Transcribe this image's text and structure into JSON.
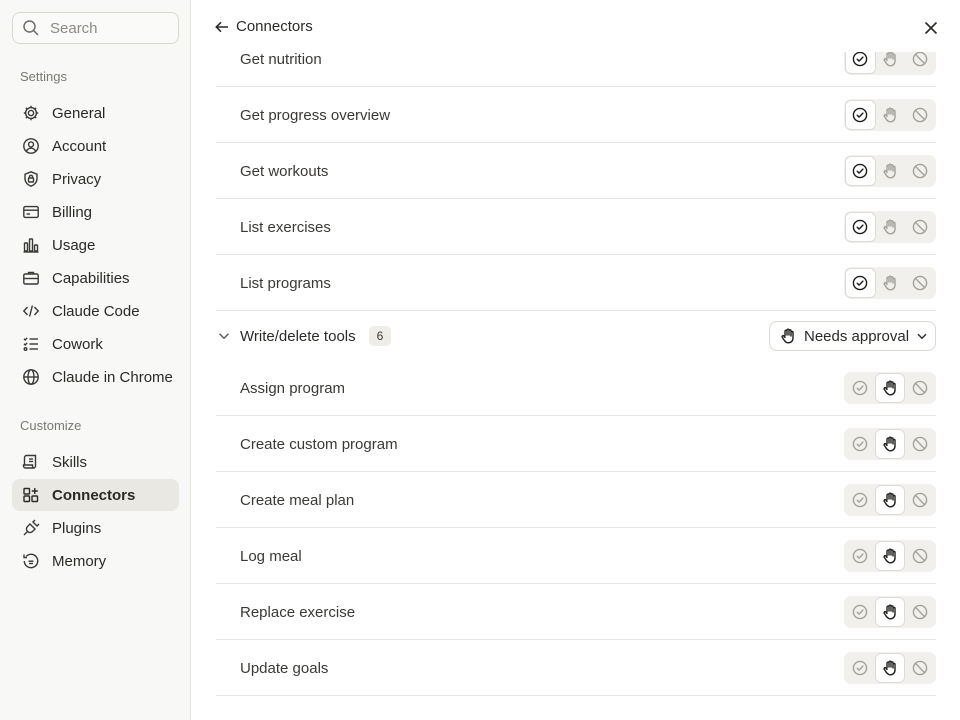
{
  "sidebar": {
    "search_placeholder": "Search",
    "settings_label": "Settings",
    "customize_label": "Customize",
    "settings_items": [
      {
        "label": "General",
        "icon": "gear-icon"
      },
      {
        "label": "Account",
        "icon": "user-circle-icon"
      },
      {
        "label": "Privacy",
        "icon": "shield-lock-icon"
      },
      {
        "label": "Billing",
        "icon": "credit-card-icon"
      },
      {
        "label": "Usage",
        "icon": "bar-chart-icon"
      },
      {
        "label": "Capabilities",
        "icon": "briefcase-icon"
      },
      {
        "label": "Claude Code",
        "icon": "code-icon"
      },
      {
        "label": "Cowork",
        "icon": "checklist-icon"
      },
      {
        "label": "Claude in Chrome",
        "icon": "globe-icon"
      }
    ],
    "customize_items": [
      {
        "label": "Skills",
        "icon": "scroll-icon"
      },
      {
        "label": "Connectors",
        "icon": "grid-plus-icon",
        "active": true
      },
      {
        "label": "Plugins",
        "icon": "plug-icon"
      },
      {
        "label": "Memory",
        "icon": "history-icon"
      }
    ]
  },
  "header": {
    "title": "Connectors"
  },
  "read_tools": [
    {
      "name": "Get nutrition",
      "permission": "allow"
    },
    {
      "name": "Get progress overview",
      "permission": "allow"
    },
    {
      "name": "Get workouts",
      "permission": "allow"
    },
    {
      "name": "List exercises",
      "permission": "allow"
    },
    {
      "name": "List programs",
      "permission": "allow"
    }
  ],
  "write_group": {
    "title": "Write/delete tools",
    "count": "6",
    "approval_label": "Needs approval",
    "tools": [
      {
        "name": "Assign program",
        "permission": "approval"
      },
      {
        "name": "Create custom program",
        "permission": "approval"
      },
      {
        "name": "Create meal plan",
        "permission": "approval"
      },
      {
        "name": "Log meal",
        "permission": "approval"
      },
      {
        "name": "Replace exercise",
        "permission": "approval"
      },
      {
        "name": "Update goals",
        "permission": "approval"
      }
    ]
  },
  "colors": {
    "sidebar_bg": "#f8f8f6",
    "active_bg": "#e9e8e3",
    "segment_bg": "#f1f0ec",
    "icon_dark": "#1f1e1c",
    "icon_muted": "#a3a19a"
  }
}
